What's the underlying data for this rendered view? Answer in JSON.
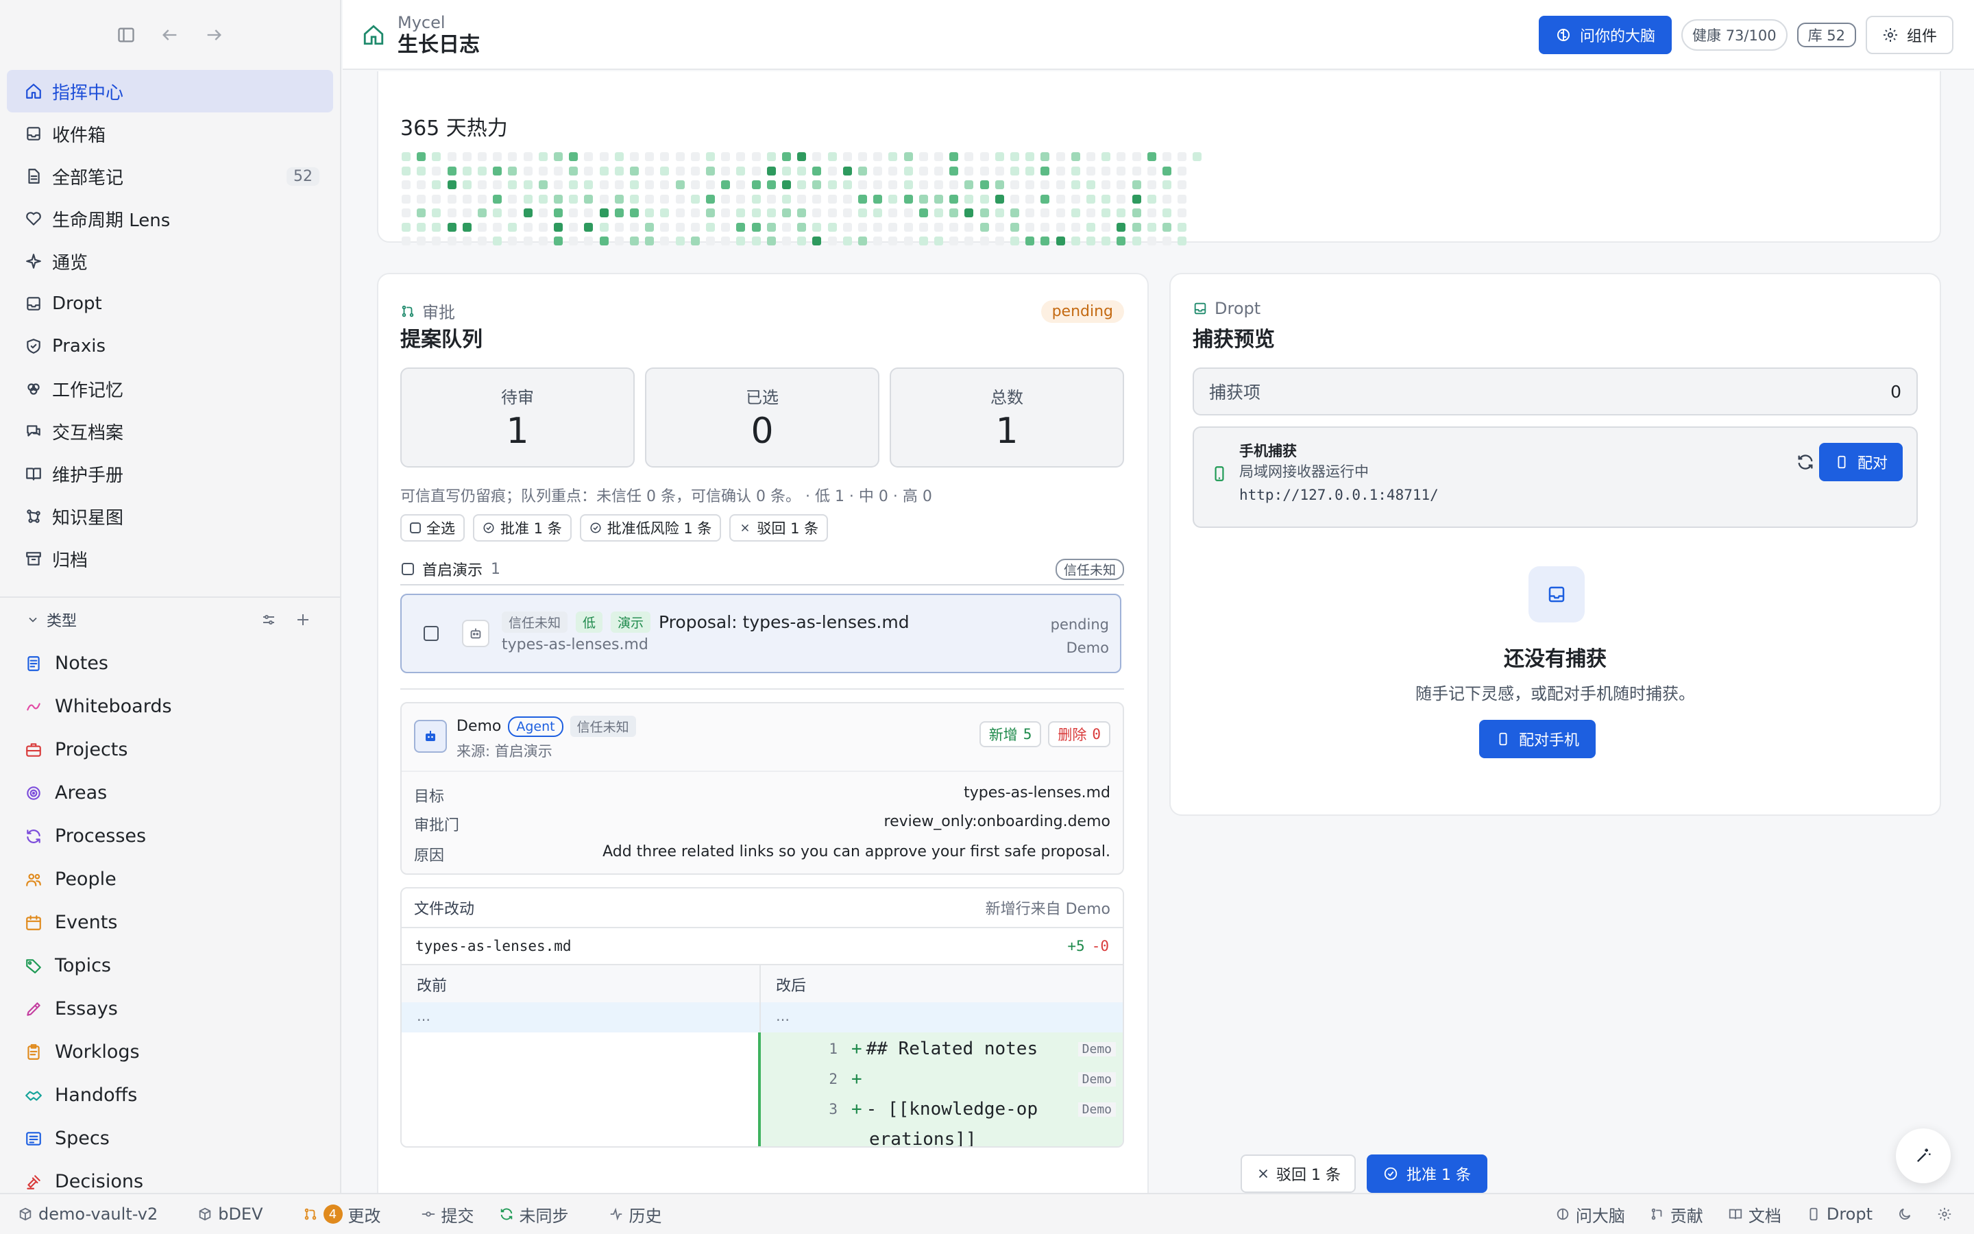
{
  "header": {
    "app": "Mycel",
    "title": "生长日志",
    "ask_brain": "问你的大脑",
    "health": "健康 73/100",
    "vault_count": "库 52",
    "widgets": "组件"
  },
  "sidebar": {
    "items": [
      {
        "label": "指挥中心",
        "icon": "home-icon",
        "active": true
      },
      {
        "label": "收件箱",
        "icon": "inbox-icon"
      },
      {
        "label": "全部笔记",
        "icon": "file-icon",
        "count": "52"
      },
      {
        "label": "生命周期 Lens",
        "icon": "heart-icon"
      },
      {
        "label": "通览",
        "icon": "sparkle-icon"
      },
      {
        "label": "Dropt",
        "icon": "tray-icon"
      },
      {
        "label": "Praxis",
        "icon": "shield-icon"
      },
      {
        "label": "工作记忆",
        "icon": "brain-icon"
      },
      {
        "label": "交互档案",
        "icon": "chat-icon"
      },
      {
        "label": "维护手册",
        "icon": "book-icon"
      },
      {
        "label": "知识星图",
        "icon": "graph-icon"
      },
      {
        "label": "归档",
        "icon": "archive-icon"
      }
    ],
    "types_label": "类型",
    "types": [
      {
        "label": "Notes",
        "icon": "notes-icon",
        "color": "#1d5fe0"
      },
      {
        "label": "Whiteboards",
        "icon": "whiteboard-icon",
        "color": "#e24aa5"
      },
      {
        "label": "Projects",
        "icon": "briefcase-icon",
        "color": "#d93b3b"
      },
      {
        "label": "Areas",
        "icon": "target-icon",
        "color": "#7c4ddb"
      },
      {
        "label": "Processes",
        "icon": "refresh-icon",
        "color": "#7c4ddb"
      },
      {
        "label": "People",
        "icon": "people-icon",
        "color": "#e08a1d"
      },
      {
        "label": "Events",
        "icon": "calendar-icon",
        "color": "#e08a1d"
      },
      {
        "label": "Topics",
        "icon": "tag-icon",
        "color": "#1f9a55"
      },
      {
        "label": "Essays",
        "icon": "pen-icon",
        "color": "#c43fa0"
      },
      {
        "label": "Worklogs",
        "icon": "clipboard-icon",
        "color": "#e08a1d"
      },
      {
        "label": "Handoffs",
        "icon": "handshake-icon",
        "color": "#16a39a"
      },
      {
        "label": "Specs",
        "icon": "spec-icon",
        "color": "#1d5fe0"
      },
      {
        "label": "Decisions",
        "icon": "gavel-icon",
        "color": "#d93b3b"
      }
    ]
  },
  "heatmap": {
    "title": "365 天热力",
    "colors": [
      "#eef0f2",
      "#cfeedd",
      "#9fd9b8",
      "#5cbb85",
      "#2e9a5e"
    ]
  },
  "proposals": {
    "section": "审批",
    "title": "提案队列",
    "status": "pending",
    "stats": [
      {
        "label": "待审",
        "value": "1"
      },
      {
        "label": "已选",
        "value": "0"
      },
      {
        "label": "总数",
        "value": "1"
      }
    ],
    "note": "可信直写仍留痕；队列重点：未信任 0 条，可信确认 0 条。 · 低 1 · 中 0 · 高 0",
    "actions": {
      "select_all": "全选",
      "approve": "批准 1 条",
      "approve_low": "批准低风险 1 条",
      "reject": "驳回 1 条"
    },
    "group": {
      "name": "首启演示",
      "count": "1",
      "trust": "信任未知"
    },
    "item": {
      "tags": [
        "信任未知",
        "低",
        "演示"
      ],
      "title": "Proposal: types-as-lenses.md",
      "file": "types-as-lenses.md",
      "status": "pending",
      "source": "Demo"
    },
    "detail": {
      "agent_name": "Demo",
      "agent_tag": "Agent",
      "trust": "信任未知",
      "source": "来源: 首启演示",
      "added_label": "新增",
      "added": "5",
      "deleted_label": "删除",
      "deleted": "0",
      "rows": [
        {
          "k": "目标",
          "v": "types-as-lenses.md"
        },
        {
          "k": "审批门",
          "v": "review_only:onboarding.demo"
        },
        {
          "k": "原因",
          "v": "Add three related links so you can approve your first safe proposal."
        }
      ]
    },
    "diff": {
      "title": "文件改动",
      "subtitle": "新增行来自 Demo",
      "file": "types-as-lenses.md",
      "plus": "+5",
      "minus": "-0",
      "before": "改前",
      "after": "改后",
      "ellipsis": "…",
      "lines": [
        {
          "n": "1",
          "text": "## Related notes",
          "src": "Demo"
        },
        {
          "n": "2",
          "text": "",
          "src": "Demo"
        },
        {
          "n": "3",
          "text": "- [[knowledge-op",
          "text2": "erations]]",
          "src": "Demo"
        }
      ]
    },
    "footer": {
      "reject": "驳回 1 条",
      "approve": "批准 1 条"
    }
  },
  "dropt": {
    "section": "Dropt",
    "title": "捕获预览",
    "captures_label": "捕获项",
    "captures_count": "0",
    "phone": {
      "title": "手机捕获",
      "status": "局域网接收器运行中",
      "url": "http://127.0.0.1:48711/",
      "pair": "配对"
    },
    "empty_title": "还没有捕获",
    "empty_desc": "随手记下灵感，或配对手机随时捕获。",
    "pair_phone": "配对手机"
  },
  "statusbar": {
    "vault": "demo-vault-v2",
    "branch": "bDEV",
    "changes_count": "4",
    "changes": "更改",
    "commit": "提交",
    "unsynced": "未同步",
    "history": "历史",
    "ask": "问大脑",
    "contribute": "贡献",
    "docs": "文档",
    "dropt": "Dropt"
  }
}
